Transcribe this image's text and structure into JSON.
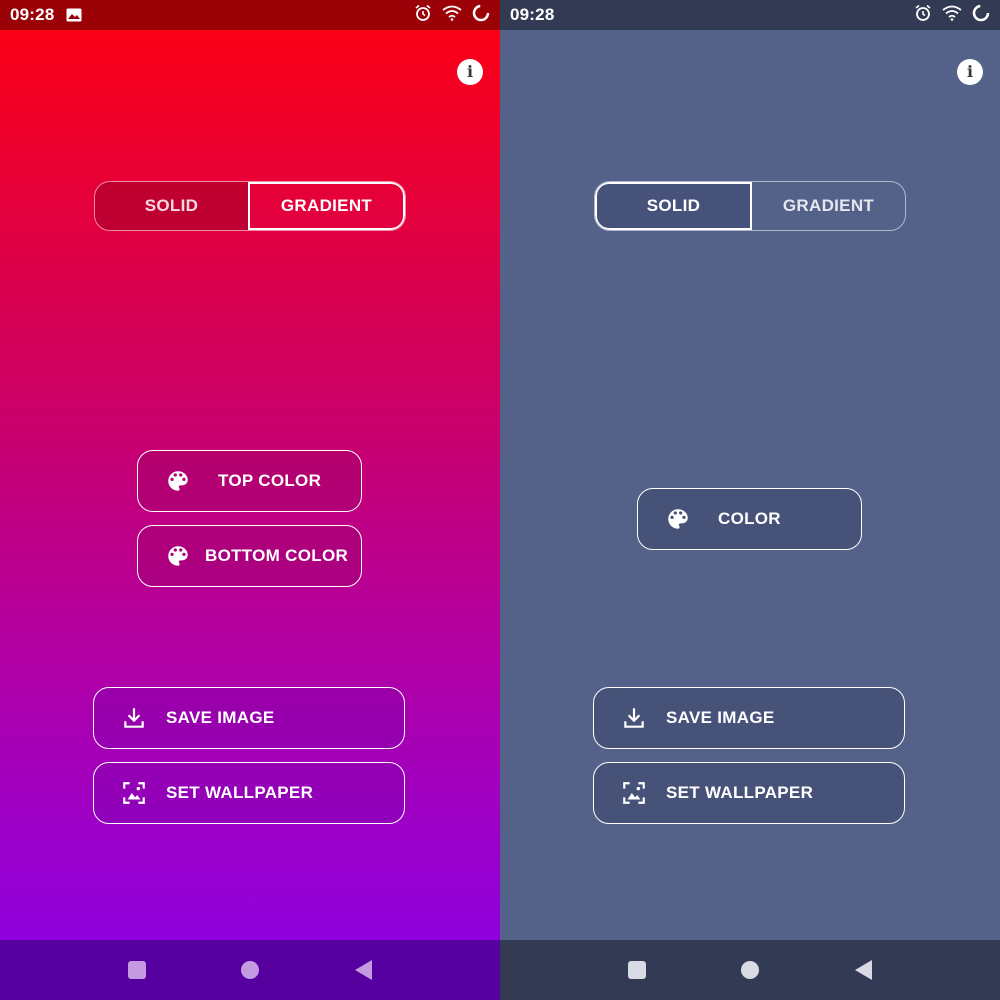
{
  "screens": [
    {
      "status": {
        "time": "09:28"
      },
      "segment": {
        "solid_label": "SOLID",
        "gradient_label": "GRADIENT",
        "selected": "GRADIENT"
      },
      "color_buttons": [
        {
          "label": "TOP COLOR",
          "icon": "palette-icon"
        },
        {
          "label": "BOTTOM COLOR",
          "icon": "palette-icon"
        }
      ],
      "actions": [
        {
          "label": "SAVE IMAGE",
          "icon": "download-icon"
        },
        {
          "label": "SET WALLPAPER",
          "icon": "wallpaper-icon"
        }
      ],
      "colors": {
        "top": "#ff0010",
        "bottom": "#8800ea"
      }
    },
    {
      "status": {
        "time": "09:28"
      },
      "segment": {
        "solid_label": "SOLID",
        "gradient_label": "GRADIENT",
        "selected": "SOLID"
      },
      "color_buttons": [
        {
          "label": "COLOR",
          "icon": "palette-icon"
        }
      ],
      "actions": [
        {
          "label": "SAVE IMAGE",
          "icon": "download-icon"
        },
        {
          "label": "SET WALLPAPER",
          "icon": "wallpaper-icon"
        }
      ],
      "colors": {
        "solid": "#54628a"
      }
    }
  ]
}
